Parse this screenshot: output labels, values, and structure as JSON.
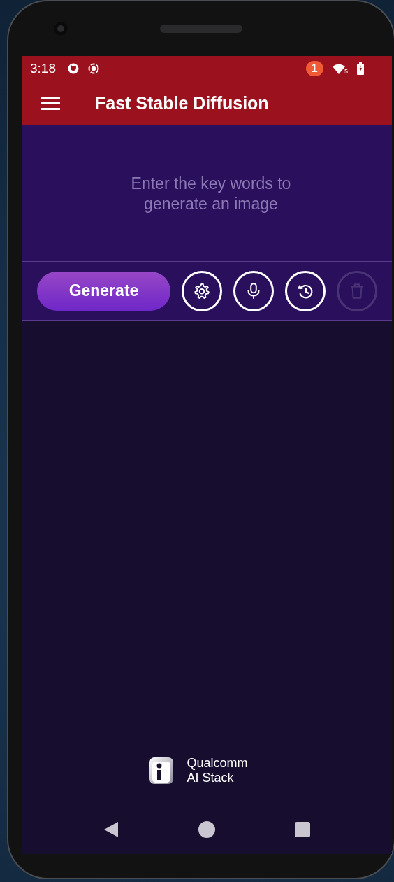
{
  "status_bar": {
    "time": "3:18",
    "notification_count": "1",
    "network_label": "5"
  },
  "toolbar": {
    "title": "Fast Stable Diffusion"
  },
  "prompt": {
    "placeholder": "Enter the key words to generate an image"
  },
  "actions": [
    {
      "kind": "generate",
      "label": "Generate",
      "disabled": false
    },
    {
      "kind": "settings",
      "disabled": false
    },
    {
      "kind": "mic",
      "disabled": false
    },
    {
      "kind": "history",
      "disabled": false
    },
    {
      "kind": "delete",
      "disabled": true
    }
  ],
  "brand": {
    "line_1": "Qualcomm",
    "line_2": "AI Stack"
  }
}
